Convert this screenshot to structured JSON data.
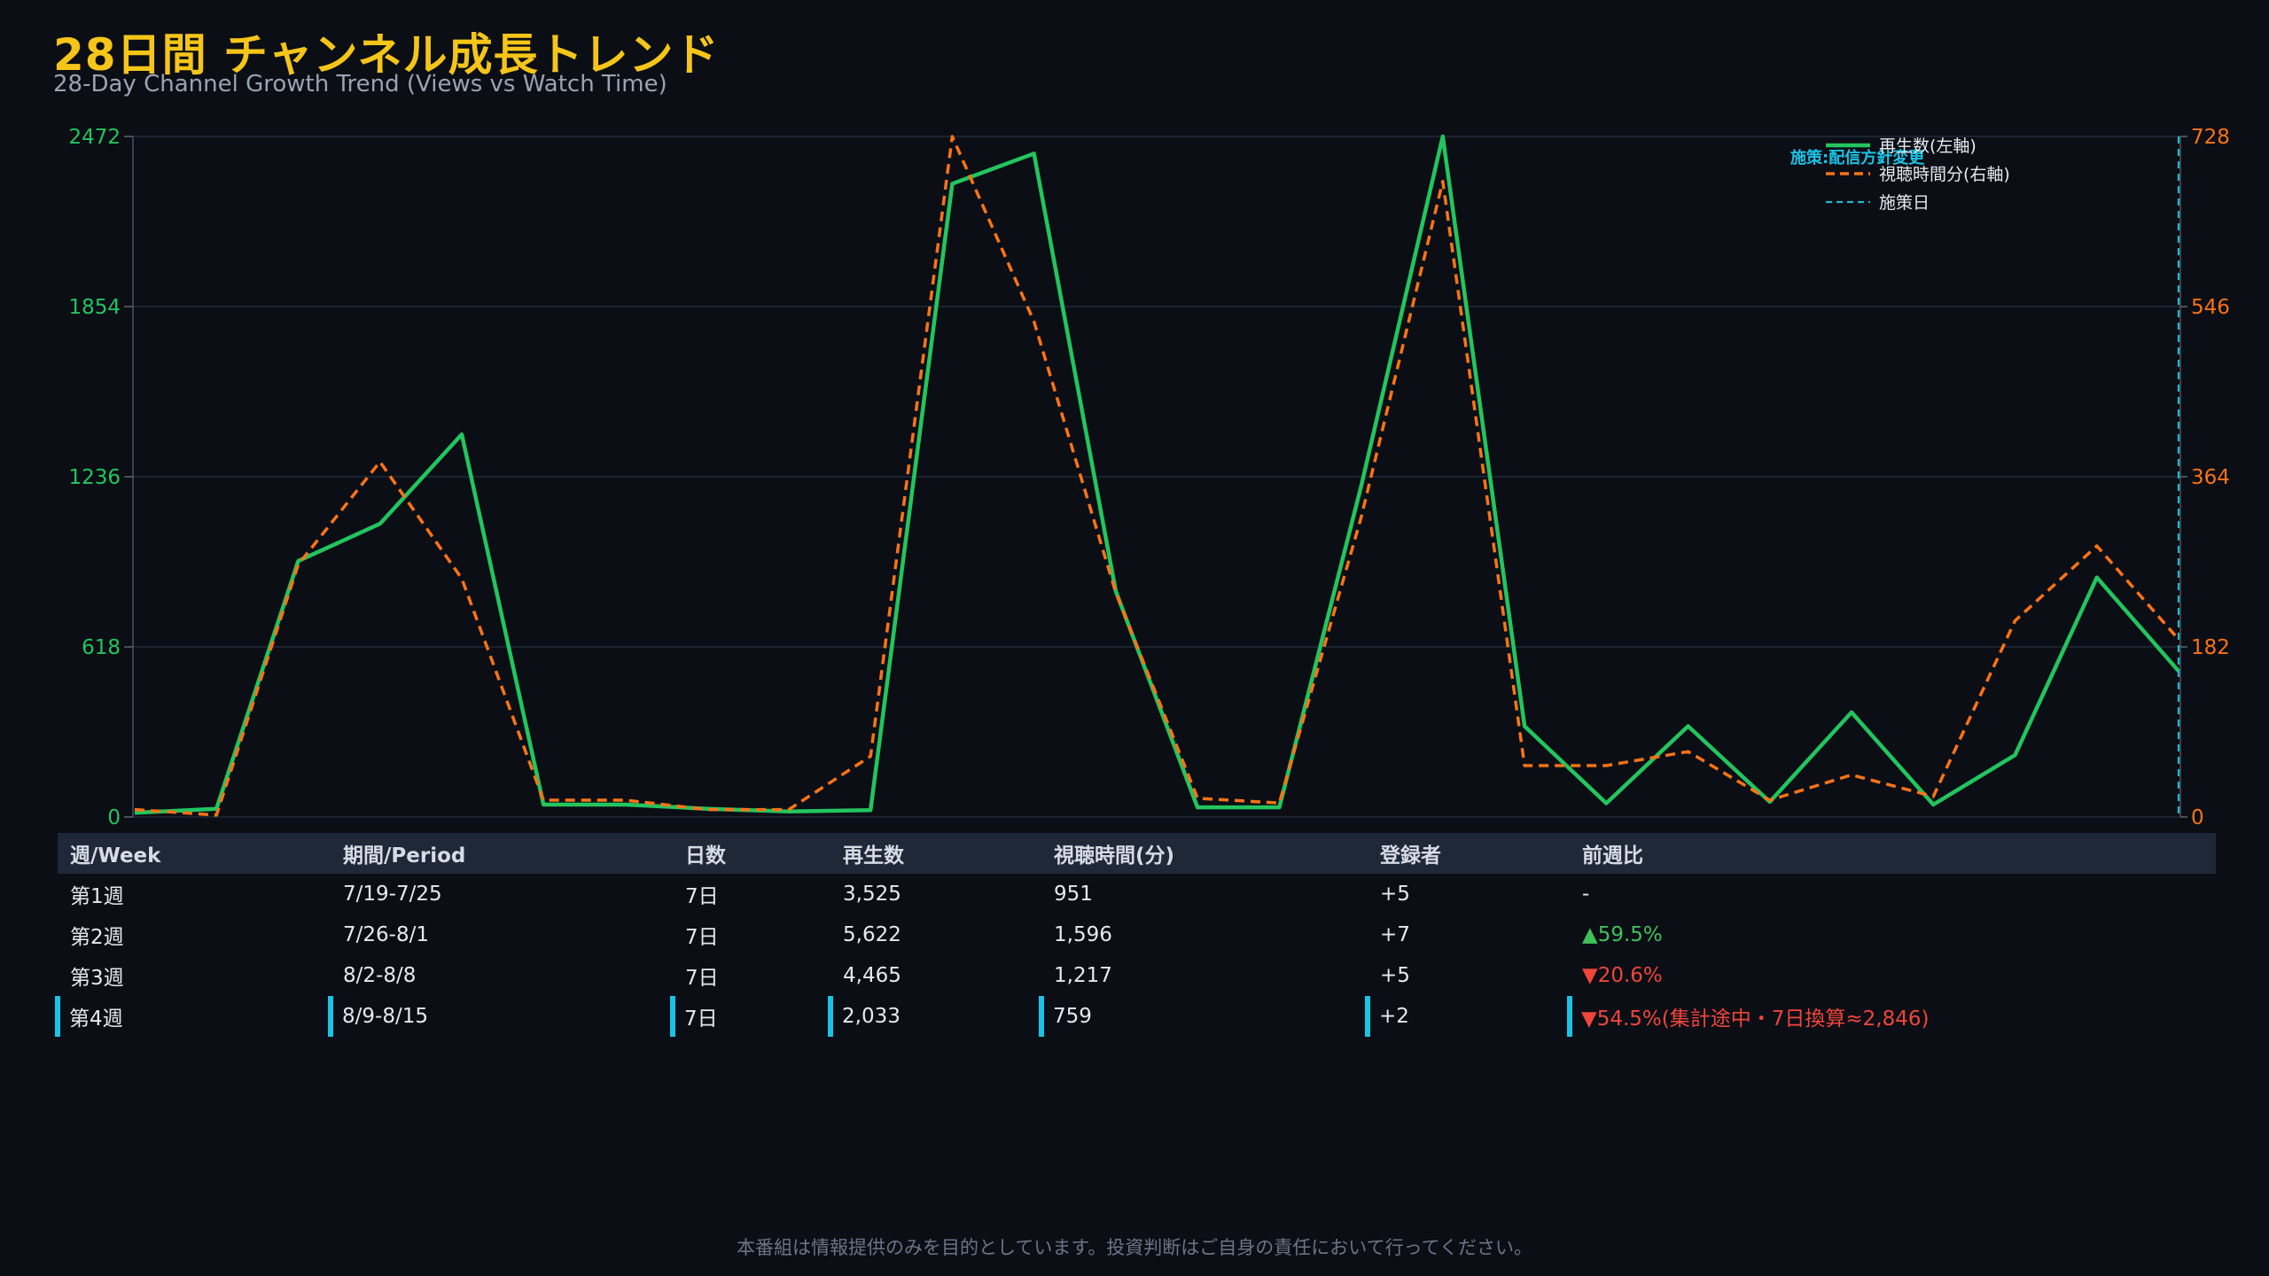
{
  "header": {
    "title": "28日間 チャンネル成長トレンド",
    "subtitle": "28-Day Channel Growth Trend (Views vs Watch Time)"
  },
  "chart_data": {
    "type": "line",
    "x": [
      1,
      2,
      3,
      4,
      5,
      6,
      7,
      8,
      9,
      10,
      11,
      12,
      13,
      14,
      15,
      16,
      17,
      18,
      19,
      20,
      21,
      22,
      23,
      24,
      25,
      26,
      27,
      28
    ],
    "series": [
      {
        "name": "再生数(左軸)",
        "axis": "left",
        "color": "#22c55e",
        "style": "solid",
        "values": [
          15,
          30,
          930,
          1065,
          1390,
          45,
          45,
          30,
          20,
          25,
          2300,
          2410,
          820,
          35,
          35,
          1200,
          2472,
          330,
          50,
          330,
          55,
          380,
          45,
          225,
          870,
          530
        ]
      },
      {
        "name": "視聴時間分(右軸)",
        "axis": "right",
        "color": "#f97316",
        "style": "dashed",
        "values": [
          8,
          2,
          270,
          380,
          255,
          18,
          18,
          8,
          8,
          65,
          728,
          530,
          240,
          20,
          15,
          320,
          680,
          55,
          55,
          70,
          18,
          45,
          22,
          210,
          290,
          190
        ]
      }
    ],
    "y_left": {
      "ylim": [
        0,
        2472
      ],
      "ticks": [
        "0",
        "618",
        "1236",
        "1854",
        "2472"
      ],
      "color": "#22c55e"
    },
    "y_right": {
      "ylim": [
        0,
        728
      ],
      "ticks": [
        "0",
        "182",
        "364",
        "546",
        "728"
      ],
      "color": "#f97316"
    },
    "event_line": {
      "index": 25,
      "label": "施策:配信方針変更",
      "legend_name": "施策日",
      "color": "#22b8cf"
    },
    "legend": {
      "placement": "top-right"
    },
    "grid": true
  },
  "table": {
    "headers": [
      "週/Week",
      "期間/Period",
      "日数",
      "再生数",
      "視聴時間(分)",
      "登録者",
      "前週比"
    ],
    "rows": [
      {
        "week": "第1週",
        "period": "7/19-7/25",
        "days": "7日",
        "views": "3,525",
        "watch": "951",
        "subs": "+5",
        "change": "-",
        "trend": ""
      },
      {
        "week": "第2週",
        "period": "7/26-8/1",
        "days": "7日",
        "views": "5,622",
        "watch": "1,596",
        "subs": "+7",
        "change": "▲59.5%",
        "trend": "pos"
      },
      {
        "week": "第3週",
        "period": "8/2-8/8",
        "days": "7日",
        "views": "4,465",
        "watch": "1,217",
        "subs": "+5",
        "change": "▼20.6%",
        "trend": "neg"
      },
      {
        "week": "第4週",
        "period": "8/9-8/15",
        "days": "7日",
        "views": "2,033",
        "watch": "759",
        "subs": "+2",
        "change": "▼54.5%(集計途中・7日換算≈2,846)",
        "trend": "neg"
      }
    ]
  },
  "footer": {
    "disclaimer": "本番組は情報提供のみを目的としています。投資判断はご自身の責任において行ってください。"
  }
}
